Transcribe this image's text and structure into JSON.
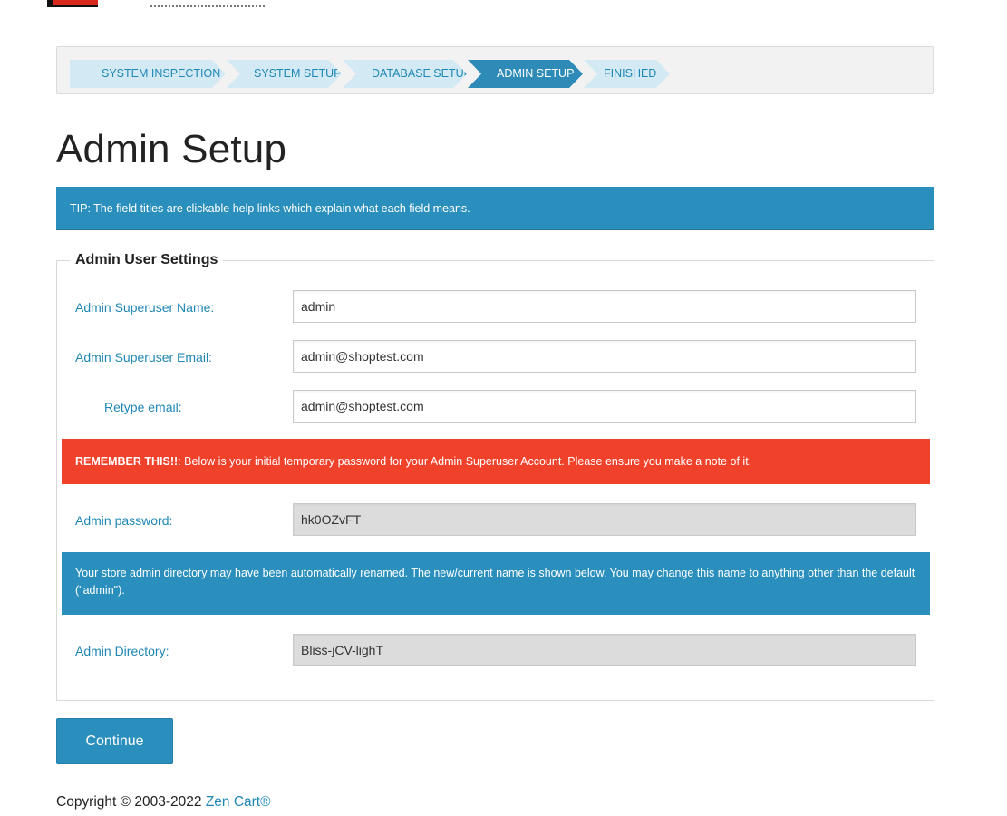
{
  "breadcrumbs": [
    {
      "label": "SYSTEM INSPECTION",
      "active": false
    },
    {
      "label": "SYSTEM SETUP",
      "active": false
    },
    {
      "label": "DATABASE SETUP",
      "active": false
    },
    {
      "label": "ADMIN SETUP",
      "active": true
    },
    {
      "label": "FINISHED",
      "active": false
    }
  ],
  "page": {
    "title": "Admin Setup",
    "tip": "TIP: The field titles are clickable help links which explain what each field means."
  },
  "form": {
    "legend": "Admin User Settings",
    "superuser_name": {
      "label": "Admin Superuser Name:",
      "value": "admin"
    },
    "superuser_email": {
      "label": "Admin Superuser Email:",
      "value": "admin@shoptest.com"
    },
    "retype_email": {
      "label": "Retype email:",
      "value": "admin@shoptest.com"
    },
    "password_alert": {
      "strong": "REMEMBER THIS!!",
      "text": ": Below is your initial temporary password for your Admin Superuser Account. Please ensure you make a note of it."
    },
    "password": {
      "label": "Admin password:",
      "value": "hk0OZvFT"
    },
    "directory_alert": "Your store admin directory may have been automatically renamed. The new/current name is shown below. You may change this name to anything other than the default (\"admin\").",
    "directory": {
      "label": "Admin Directory:",
      "value": "Bliss-jCV-lighT"
    }
  },
  "actions": {
    "continue_label": "Continue"
  },
  "footer": {
    "copyright": "Copyright © 2003-2022 ",
    "link": "Zen Cart®"
  },
  "colors": {
    "accent": "#2a8fbd",
    "link": "#1e87b5",
    "alert_red": "#f0412a",
    "crumb_bg": "#d3eaf4"
  }
}
